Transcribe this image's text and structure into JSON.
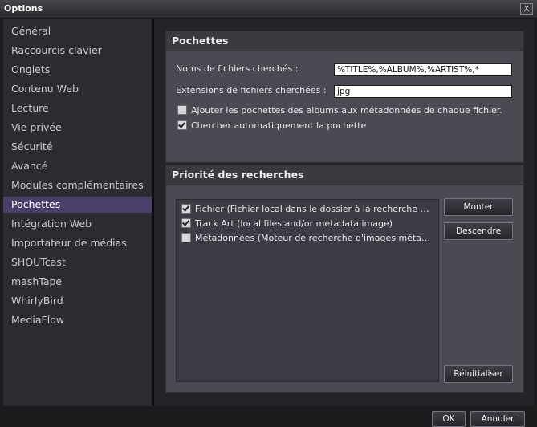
{
  "window": {
    "title": "Options",
    "close_label": "X"
  },
  "sidebar": {
    "items": [
      {
        "label": "Général"
      },
      {
        "label": "Raccourcis clavier"
      },
      {
        "label": "Onglets"
      },
      {
        "label": "Contenu Web"
      },
      {
        "label": "Lecture"
      },
      {
        "label": "Vie privée"
      },
      {
        "label": "Sécurité"
      },
      {
        "label": "Avancé"
      },
      {
        "label": "Modules complémentaires"
      },
      {
        "label": "Pochettes"
      },
      {
        "label": "Intégration Web"
      },
      {
        "label": "Importateur de médias"
      },
      {
        "label": "SHOUTcast"
      },
      {
        "label": "mashTape"
      },
      {
        "label": "WhirlyBird"
      },
      {
        "label": "MediaFlow"
      }
    ],
    "selected": "Pochettes"
  },
  "pochettes": {
    "title": "Pochettes",
    "filenames_label": "Noms de fichiers cherchés :",
    "filenames_value": "%TITLE%,%ALBUM%,%ARTIST%,*",
    "extensions_label": "Extensions de fichiers cherchées :",
    "extensions_value": "jpg",
    "add_to_metadata": {
      "label": "Ajouter les pochettes des albums aux métadonnées de chaque fichier.",
      "checked": false
    },
    "auto_search": {
      "label": "Chercher automatiquement la pochette",
      "checked": true
    }
  },
  "priority": {
    "title": "Priorité des recherches",
    "items": [
      {
        "label": "Fichier (Fichier local dans le dossier à la recherche d'...",
        "checked": true
      },
      {
        "label": "Track Art (local files and/or metadata image)",
        "checked": true
      },
      {
        "label": "Métadonnées (Moteur de recherche d'images métad...",
        "checked": false
      }
    ],
    "move_up_label": "Monter",
    "move_down_label": "Descendre",
    "reset_label": "Réinitialiser"
  },
  "footer": {
    "ok_label": "OK",
    "cancel_label": "Annuler"
  },
  "colors": {
    "accent": "#4a3f6b",
    "panel": "#4a4a52",
    "background": "#1c1c1f"
  }
}
